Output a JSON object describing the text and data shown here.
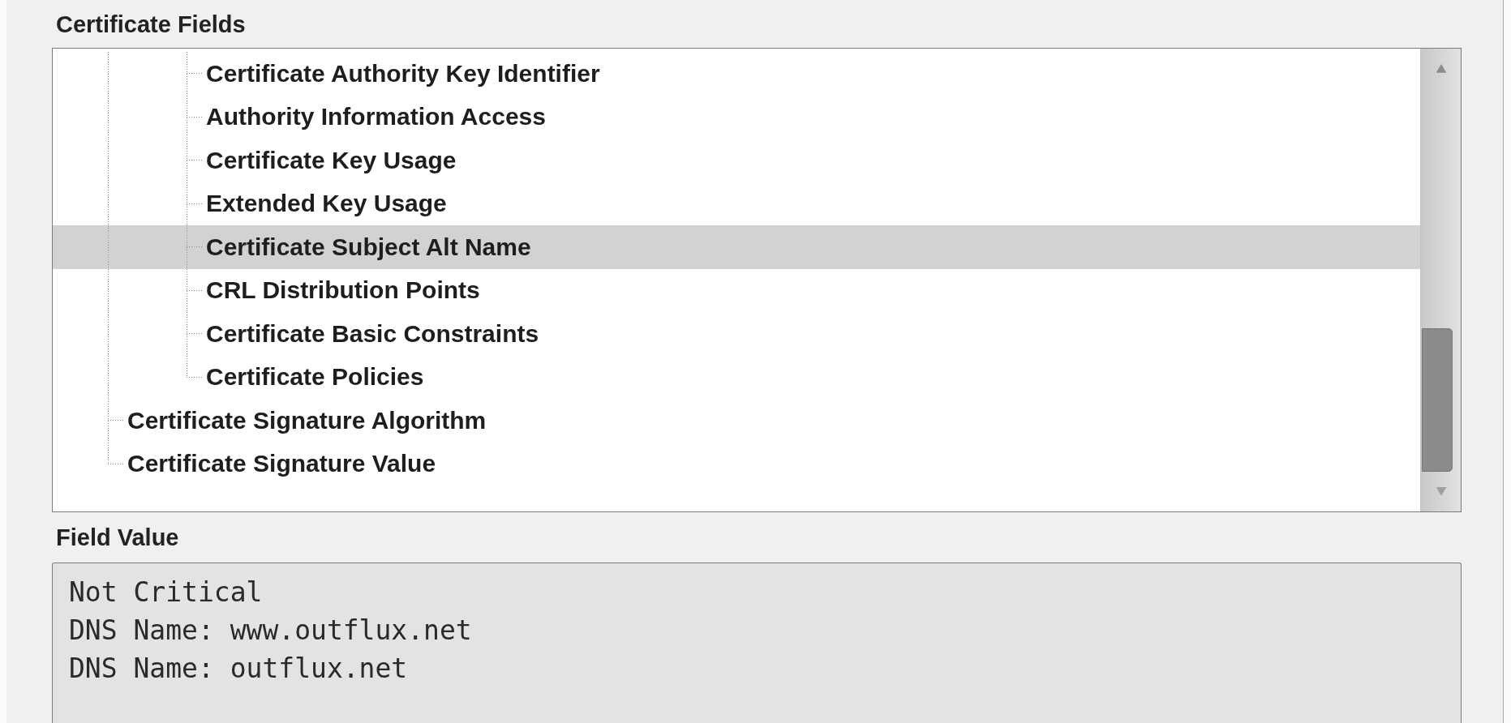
{
  "certificate_fields": {
    "heading": "Certificate Fields",
    "tree": {
      "scrolled_branch": {
        "children": [
          {
            "label": "Certificate Authority Key Identifier",
            "selected": false
          },
          {
            "label": "Authority Information Access",
            "selected": false
          },
          {
            "label": "Certificate Key Usage",
            "selected": false
          },
          {
            "label": "Extended Key Usage",
            "selected": false
          },
          {
            "label": "Certificate Subject Alt Name",
            "selected": true
          },
          {
            "label": "CRL Distribution Points",
            "selected": false
          },
          {
            "label": "Certificate Basic Constraints",
            "selected": false
          },
          {
            "label": "Certificate Policies",
            "selected": false
          }
        ]
      },
      "items": [
        {
          "label": "Certificate Signature Algorithm",
          "selected": false
        },
        {
          "label": "Certificate Signature Value",
          "selected": false
        }
      ]
    }
  },
  "field_value": {
    "heading": "Field Value",
    "lines": [
      "Not Critical",
      "DNS Name: www.outflux.net",
      "DNS Name: outflux.net"
    ]
  }
}
